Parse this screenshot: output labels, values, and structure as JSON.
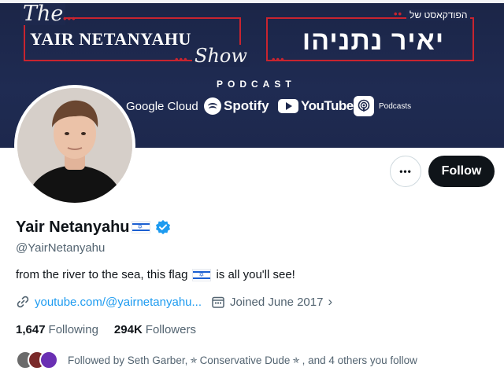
{
  "banner": {
    "the_word": "The",
    "title": "YAIR NETANYAHU",
    "show_word": "Show",
    "hebrew_small": "הפודקאסט של",
    "hebrew_big": "יאיר נתניהו",
    "podcast_label": "PODCAST",
    "platforms": {
      "google": "Google Cloud",
      "spotify": "Spotify",
      "youtube": "YouTube",
      "podcasts": "Podcasts"
    }
  },
  "profile": {
    "display_name": "Yair Netanyahu",
    "handle": "@YairNetanyahu",
    "bio_before": "from the river to the sea, this flag",
    "bio_after": "is all you'll see!",
    "link": "youtube.com/@yairnetanyahu...",
    "joined": "Joined June 2017",
    "following_count": "1,647",
    "following_label": "Following",
    "followers_count": "294K",
    "followers_label": "Followers",
    "followed_by_prefix": "Followed by Seth Garber,",
    "followed_by_mid": "Conservative Dude",
    "followed_by_suffix": ", and 4 others you follow"
  },
  "actions": {
    "follow_label": "Follow",
    "more_label": "•••"
  },
  "colors": {
    "banner_bg": "#1d284d",
    "banner_accent": "#c8242f",
    "link": "#1d9bf0",
    "verified": "#1d9bf0",
    "follow_bg": "#0f1419"
  }
}
